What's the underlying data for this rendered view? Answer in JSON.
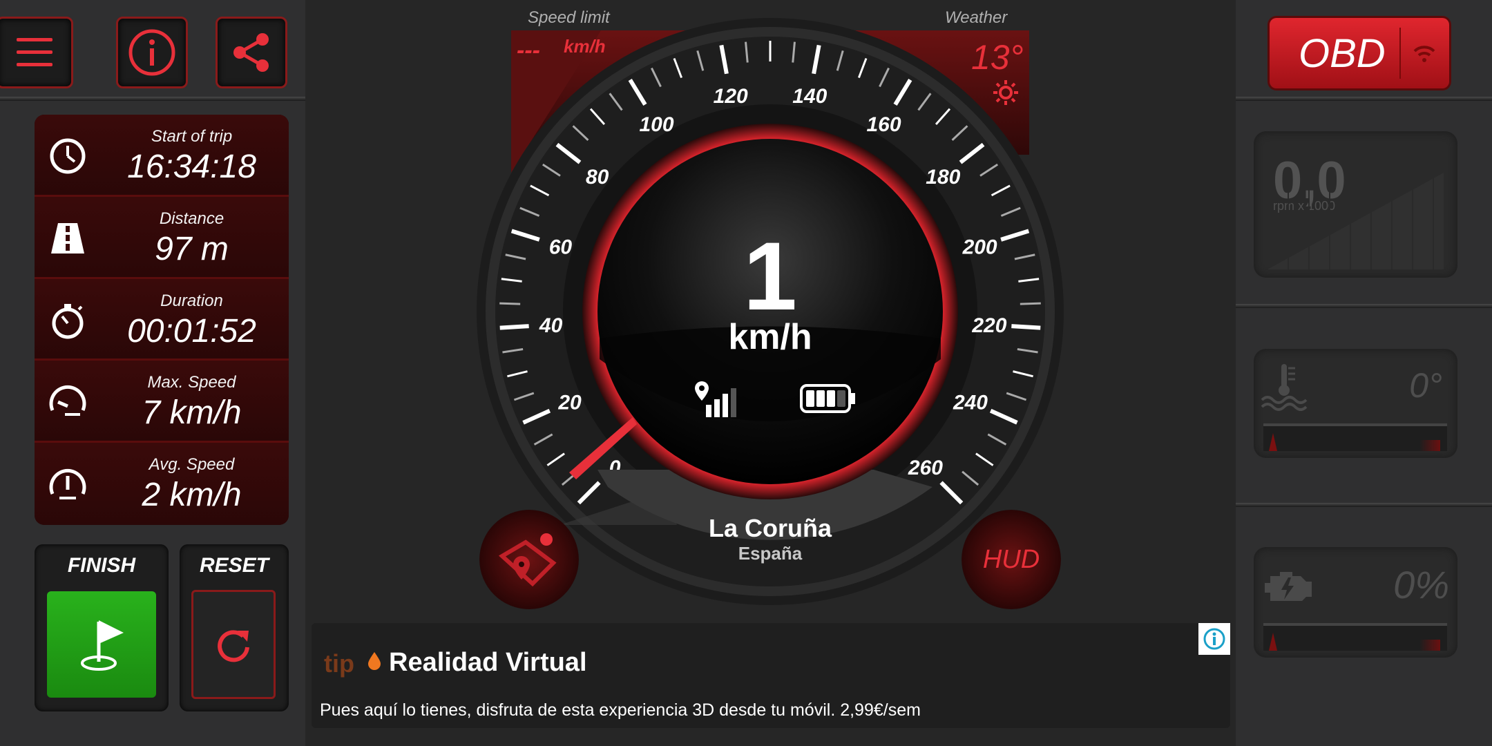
{
  "header_buttons": {
    "menu": "menu-icon",
    "info": "info-icon",
    "share": "share-icon"
  },
  "trip": {
    "start": {
      "label": "Start of trip",
      "value": "16:34:18",
      "icon": "clock-icon"
    },
    "distance": {
      "label": "Distance",
      "value": "97 m",
      "icon": "road-icon"
    },
    "duration": {
      "label": "Duration",
      "value": "00:01:52",
      "icon": "stopwatch-icon"
    },
    "max_speed": {
      "label": "Max. Speed",
      "value": "7 km/h",
      "icon": "speedometer-max-icon"
    },
    "avg_speed": {
      "label": "Avg. Speed",
      "value": "2 km/h",
      "icon": "speedometer-avg-icon"
    }
  },
  "actions": {
    "finish_label": "FINISH",
    "reset_label": "RESET"
  },
  "speedometer": {
    "speed_limit_label": "Speed limit",
    "speed_limit_value": "---",
    "speed_limit_unit": "km/h",
    "weather_label": "Weather",
    "weather_value": "13°",
    "speed": "1",
    "unit": "km/h",
    "ticks": [
      "0",
      "20",
      "40",
      "60",
      "80",
      "100",
      "120",
      "140",
      "160",
      "180",
      "200",
      "220",
      "240",
      "260"
    ],
    "city": "La Coruña",
    "country": "España",
    "hud_label": "HUD"
  },
  "obd": {
    "button_label": "OBD",
    "rpm_value": "0,0",
    "rpm_unit": "rpm x 1000",
    "temp_value": "0°",
    "load_value": "0%"
  },
  "ad": {
    "brand": "tip",
    "title": "Realidad Virtual",
    "text": "Pues aquí lo tienes, disfruta de esta experiencia 3D desde tu móvil. 2,99€/sem"
  },
  "colors": {
    "accent": "#e8303a",
    "dark_red": "#3a0a0a",
    "finish_green": "#1f9a14"
  }
}
